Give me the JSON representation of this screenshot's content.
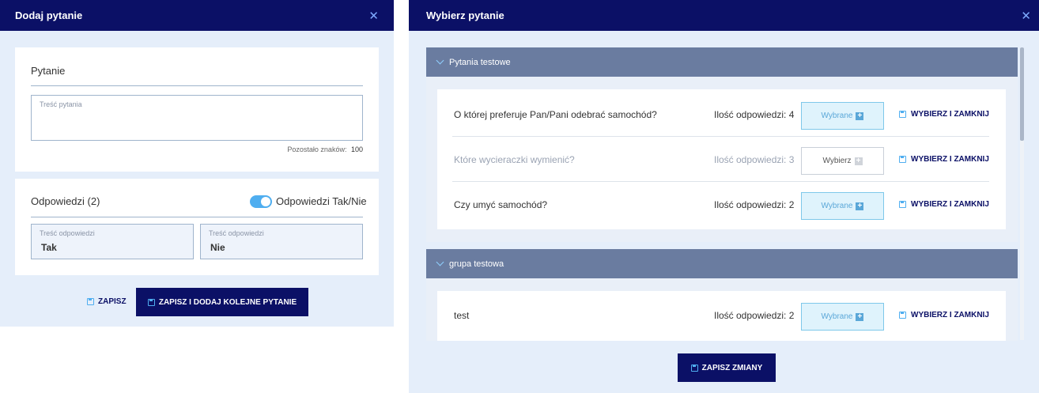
{
  "left": {
    "title": "Dodaj pytanie",
    "question_section": "Pytanie",
    "question_placeholder": "Treść pytania",
    "chars_left_label": "Pozostało znaków:",
    "chars_left_value": "100",
    "answers_section": "Odpowiedzi (2)",
    "yes_no_toggle_label": "Odpowiedzi Tak/Nie",
    "yes_no_enabled": true,
    "answers": [
      {
        "label": "Treść odpowiedzi",
        "value": "Tak"
      },
      {
        "label": "Treść odpowiedzi",
        "value": "Nie"
      }
    ],
    "save_label": "ZAPISZ",
    "save_add_label": "ZAPISZ I DODAJ KOLEJNE PYTANIE"
  },
  "right": {
    "title": "Wybierz pytanie",
    "groups": [
      {
        "name": "Pytania testowe",
        "questions": [
          {
            "text": "O której preferuje Pan/Pani odebrać samochód?",
            "count": "Ilość odpowiedzi: 4",
            "select_label": "Wybrane",
            "selected": true,
            "close_label": "WYBIERZ I ZAMKNIJ"
          },
          {
            "text": "Które wycieraczki wymienić?",
            "count": "Ilość odpowiedzi: 3",
            "select_label": "Wybierz",
            "selected": false,
            "close_label": "WYBIERZ I ZAMKNIJ"
          },
          {
            "text": "Czy umyć samochód?",
            "count": "Ilość odpowiedzi: 2",
            "select_label": "Wybrane",
            "selected": true,
            "close_label": "WYBIERZ I ZAMKNIJ"
          }
        ]
      },
      {
        "name": "grupa testowa",
        "questions": [
          {
            "text": "test",
            "count": "Ilość odpowiedzi: 2",
            "select_label": "Wybrane",
            "selected": true,
            "close_label": "WYBIERZ I ZAMKNIJ"
          }
        ]
      }
    ],
    "save_changes_label": "ZAPISZ ZMIANY"
  },
  "colors": {
    "navy": "#0b1066",
    "panel_bg": "#e5eefa",
    "group_header": "#6a7ca0",
    "accent": "#4faef0"
  },
  "icons": [
    "close-icon",
    "save-icon",
    "chevron-down-icon",
    "plus-icon"
  ]
}
